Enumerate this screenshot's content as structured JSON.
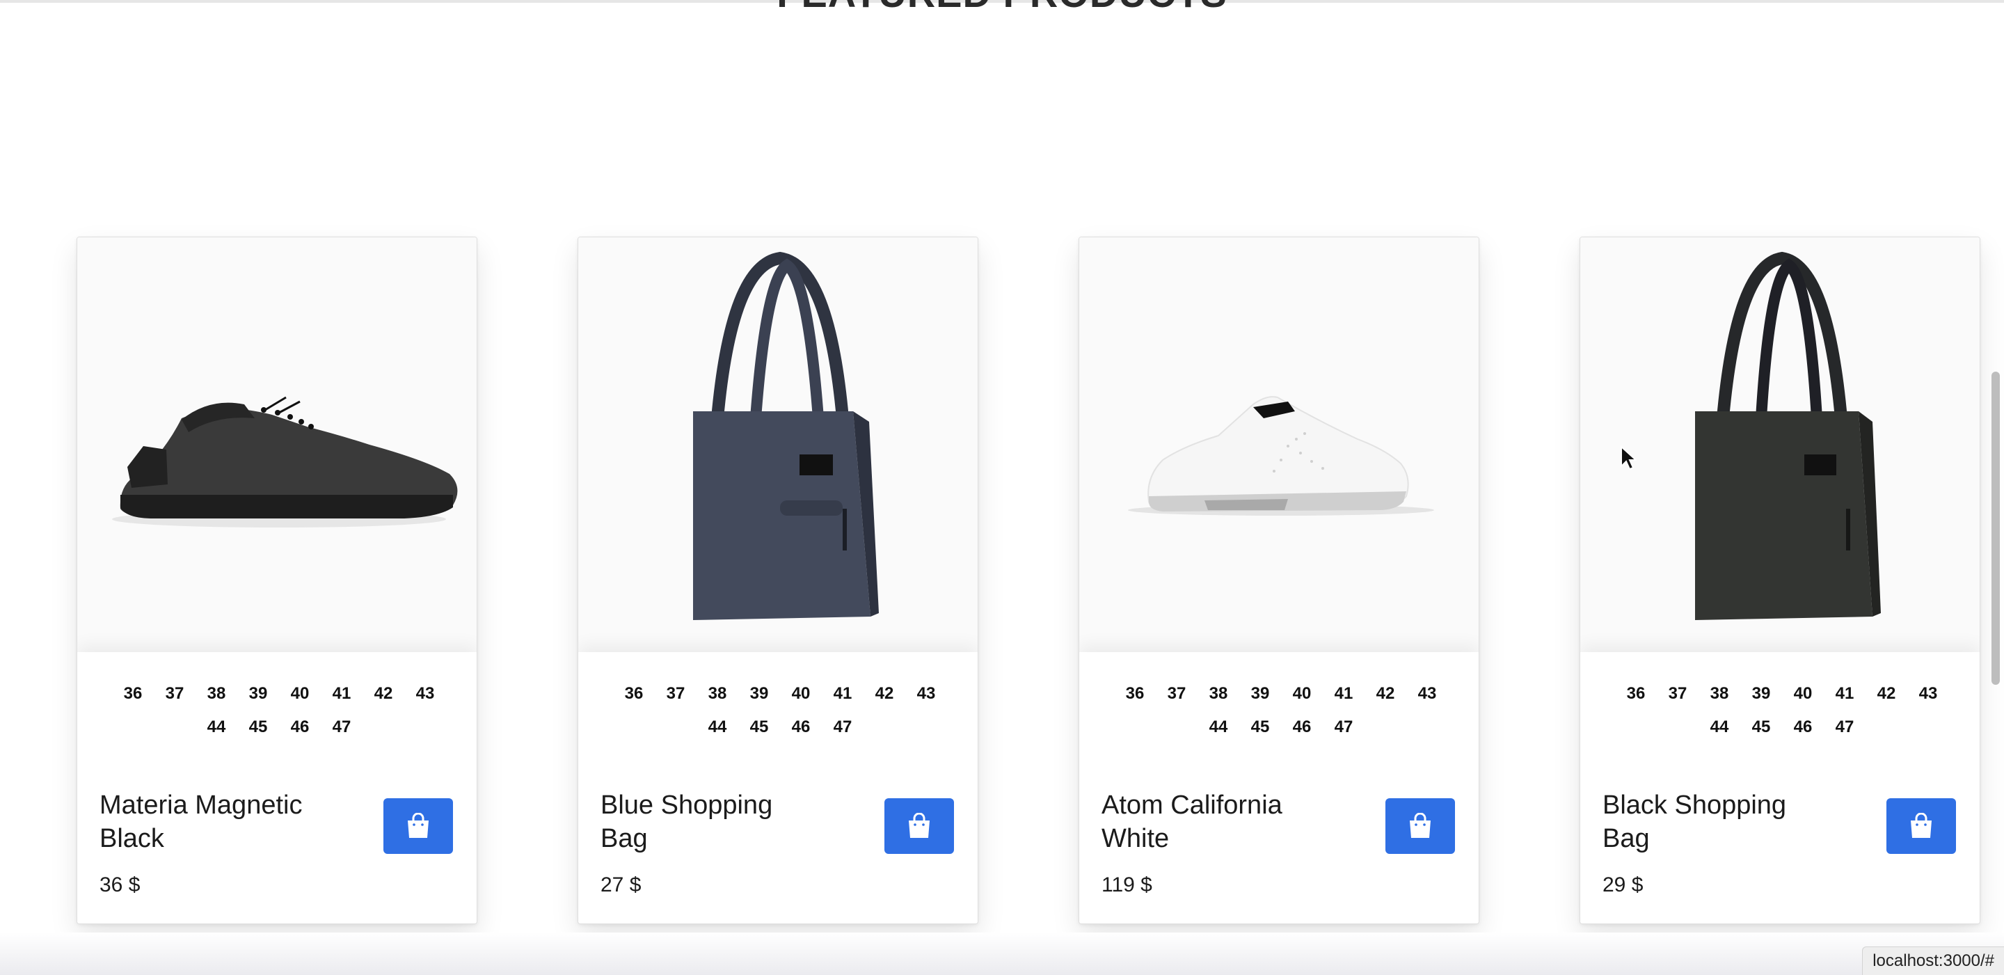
{
  "section": {
    "title": "FEATURED PRODUCTS"
  },
  "products": [
    {
      "name": "Materia Magnetic Black",
      "price": "36 $",
      "image_icon": "black-sneaker-image",
      "sizes": [
        "36",
        "37",
        "38",
        "39",
        "40",
        "41",
        "42",
        "43",
        "44",
        "45",
        "46",
        "47"
      ]
    },
    {
      "name": "Blue Shopping Bag",
      "price": "27 $",
      "image_icon": "blue-tote-bag-image",
      "sizes": [
        "36",
        "37",
        "38",
        "39",
        "40",
        "41",
        "42",
        "43",
        "44",
        "45",
        "46",
        "47"
      ]
    },
    {
      "name": "Atom California White",
      "price": "119 $",
      "image_icon": "white-sneaker-image",
      "sizes": [
        "36",
        "37",
        "38",
        "39",
        "40",
        "41",
        "42",
        "43",
        "44",
        "45",
        "46",
        "47"
      ]
    },
    {
      "name": "Black Shopping Bag",
      "price": "29 $",
      "image_icon": "black-tote-bag-image",
      "sizes": [
        "36",
        "37",
        "38",
        "39",
        "40",
        "41",
        "42",
        "43",
        "44",
        "45",
        "46",
        "47"
      ]
    }
  ],
  "cart_icon": "shopping-bag-icon",
  "accent_color": "#2f6fe4",
  "status_bar": {
    "url": "localhost:3000/#"
  }
}
